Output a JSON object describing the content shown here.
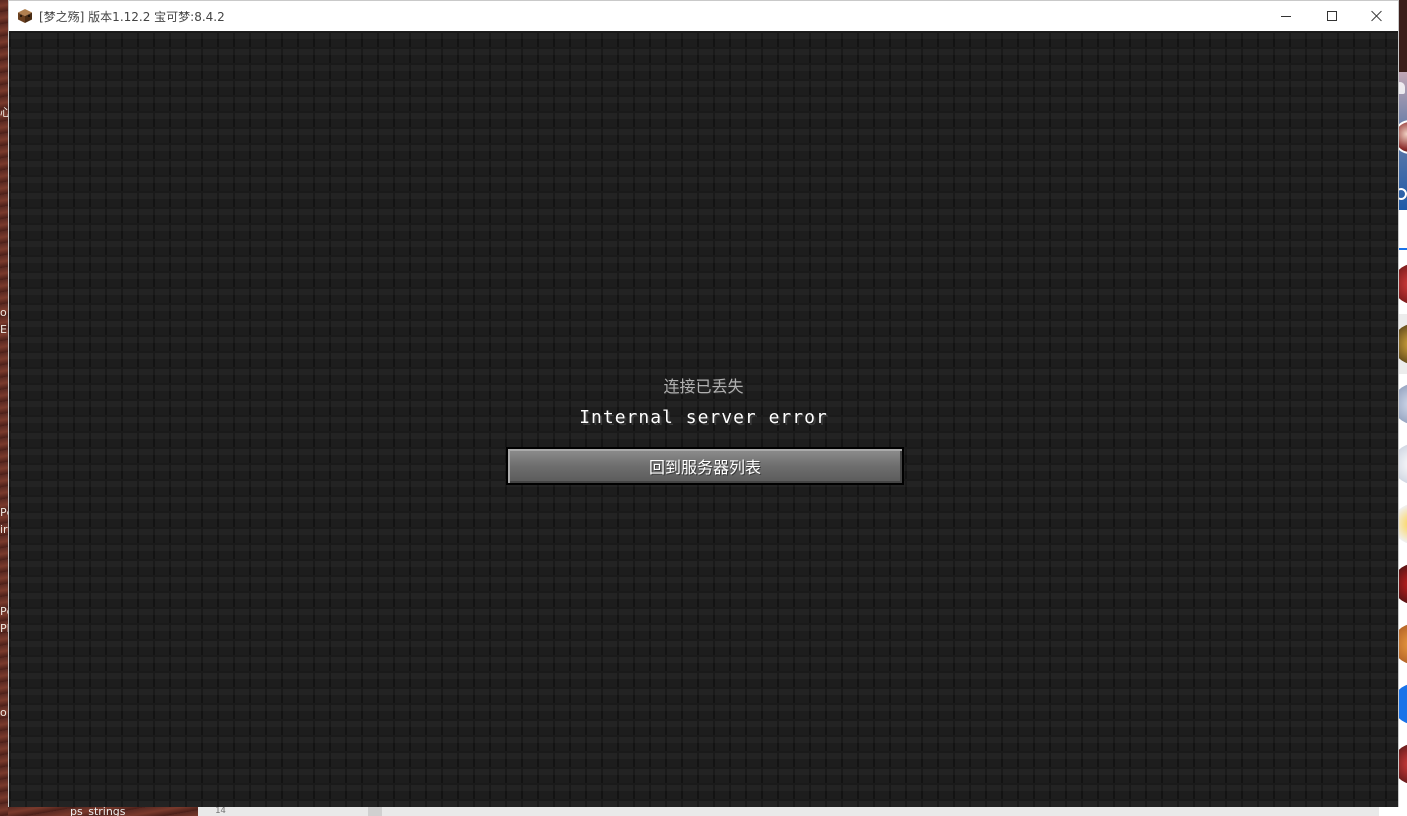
{
  "window": {
    "title": "[梦之殇] 版本1.12.2 宝可梦:8.4.2",
    "controls": {
      "minimize": "minimize-icon",
      "maximize": "maximize-icon",
      "close": "close-icon"
    }
  },
  "screen": {
    "heading": "连接已丢失",
    "message": "Internal server error",
    "back_button_label": "回到服务器列表"
  },
  "desktop": {
    "left_fragments": [
      "心",
      "o",
      "Eı",
      "Pc",
      "ir",
      "Pc",
      "Pla",
      "o"
    ],
    "bottom_text": "ps_strings",
    "bottom_number": "14"
  },
  "colors": {
    "game_background": "#1e1e1e",
    "button_face": "#707070",
    "message_text": "#ffffff",
    "heading_text": "#b0b0b0",
    "accent": "#1a73e8"
  }
}
